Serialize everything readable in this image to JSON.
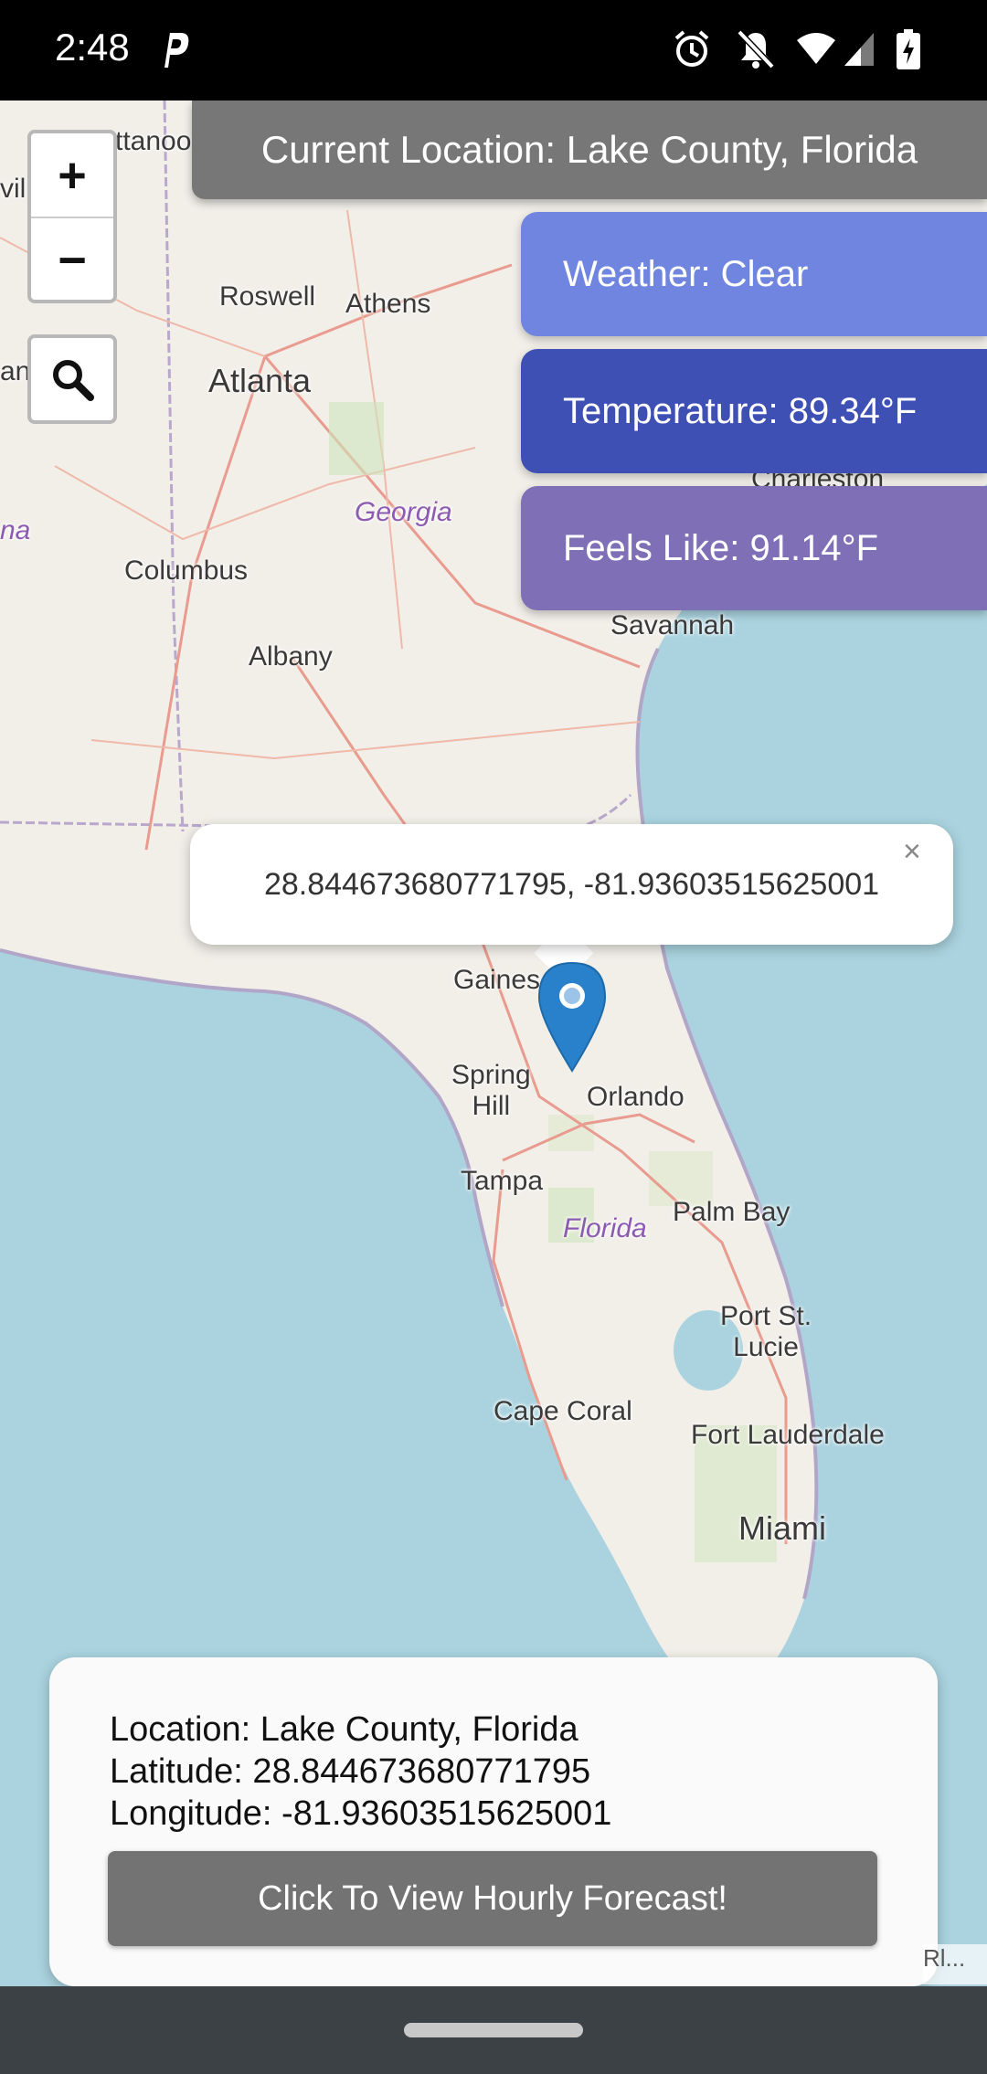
{
  "status_bar": {
    "time": "2:48",
    "icons": [
      "parking-p-icon",
      "alarm-icon",
      "notifications-off-icon",
      "wifi-icon",
      "signal-icon",
      "battery-charging-icon"
    ]
  },
  "map": {
    "zoom_in_label": "+",
    "zoom_out_label": "−",
    "search_icon": "search-icon",
    "labels": {
      "chattanooga": "ttanoo",
      "roswell": "Roswell",
      "athens": "Athens",
      "atlanta": "Atlanta",
      "georgia": "Georgia",
      "columbus": "Columbus",
      "albany": "Albany",
      "savannah": "Savannah",
      "charleston": "Charleston",
      "gainesville": "Gaines",
      "spring_hill": "Spring\nHill",
      "orlando": "Orlando",
      "tampa": "Tampa",
      "florida": "Florida",
      "palm_bay": "Palm Bay",
      "port_st_lucie": "Port St.\nLucie",
      "cape_coral": "Cape Coral",
      "fort_lauderdale": "Fort Lauderdale",
      "miami": "Miami",
      "left_edge_1": "vil",
      "left_edge_2": "an",
      "left_edge_3": "na"
    },
    "attribution": "Rl..."
  },
  "location_banner": "Current Location: Lake County, Florida",
  "weather_cards": {
    "weather": "Weather: Clear",
    "temperature": "Temperature: 89.34°F",
    "feels_like": "Feels Like: 91.14°F"
  },
  "popup": {
    "coords": "28.844673680771795, -81.93603515625001",
    "close_label": "×"
  },
  "info_panel": {
    "location": "Location: Lake County, Florida",
    "latitude": "Latitude: 28.844673680771795",
    "longitude": "Longitude: -81.93603515625001",
    "button_label": "Click To View Hourly Forecast!"
  },
  "colors": {
    "banner": "#777777",
    "weather_card": "#6f85df",
    "temperature_card": "#3f50b5",
    "feels_like_card": "#7e6fb7",
    "marker": "#2a81cb"
  }
}
